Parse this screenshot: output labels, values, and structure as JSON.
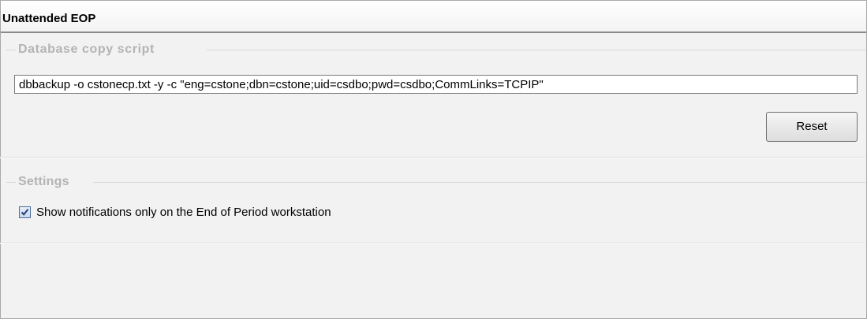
{
  "panel": {
    "title": "Unattended EOP"
  },
  "database_copy_script": {
    "caption": "Database copy script",
    "script_value": "dbbackup -o cstonecp.txt -y -c \"eng=cstone;dbn=cstone;uid=csdbo;pwd=csdbo;CommLinks=TCPIP\"",
    "reset_label": "Reset"
  },
  "settings": {
    "caption": "Settings",
    "notifications_checkbox": {
      "label": "Show notifications only on the End of Period workstation",
      "checked": true
    }
  },
  "icons": {
    "checkmark": "checkmark-icon"
  },
  "colors": {
    "header_rule": "#8a8a8a",
    "body_background": "#f2f2f2",
    "group_caption": "#b4b4b4",
    "checkbox_border": "#4b6e9c",
    "checkmark": "#1e3f7a"
  }
}
